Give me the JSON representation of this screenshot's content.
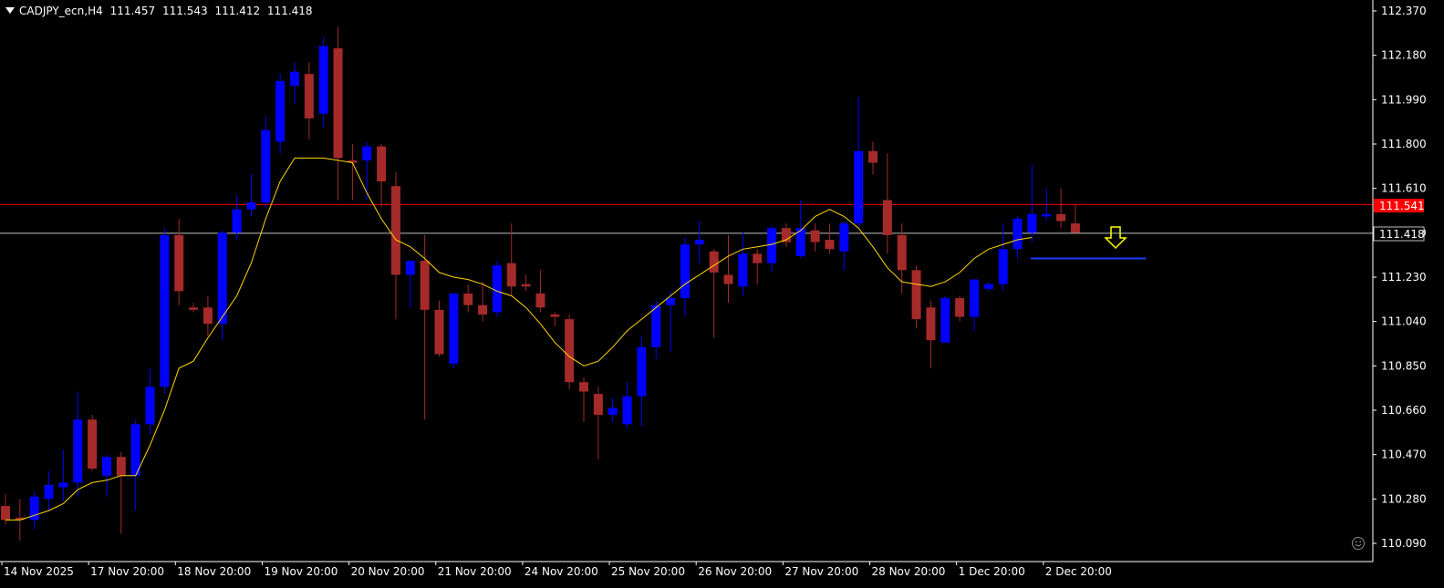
{
  "header": {
    "symbol": "CADJPY_ecn,H4",
    "open": "111.457",
    "high": "111.543",
    "low": "111.412",
    "close": "111.418"
  },
  "colors": {
    "background": "#000000",
    "bull": "#0000ff",
    "bear": "#a52a2a",
    "ma": "#ffd700",
    "resistance": "#ff0000",
    "bid": "#c0c0c0",
    "support": "#1e3cff",
    "arrow": "#ffff00",
    "axis": "#ffffff"
  },
  "price_tags": {
    "resistance": "111.541",
    "bid": "111.418"
  },
  "chart_data": {
    "type": "candlestick",
    "y_ticks": [
      "112.370",
      "112.180",
      "111.990",
      "111.800",
      "111.610",
      "111.420",
      "111.230",
      "111.040",
      "110.850",
      "110.660",
      "110.470",
      "110.280",
      "110.090"
    ],
    "x_ticks": [
      "14 Nov 2025",
      "17 Nov 20:00",
      "18 Nov 20:00",
      "19 Nov 20:00",
      "20 Nov 20:00",
      "21 Nov 20:00",
      "24 Nov 20:00",
      "25 Nov 20:00",
      "26 Nov 20:00",
      "27 Nov 20:00",
      "28 Nov 20:00",
      "1 Dec 20:00",
      "2 Dec 20:00"
    ],
    "ylim": [
      110.06,
      112.4
    ],
    "candles": [
      {
        "o": 110.25,
        "h": 110.3,
        "l": 110.17,
        "c": 110.19
      },
      {
        "o": 110.2,
        "h": 110.28,
        "l": 110.1,
        "c": 110.19
      },
      {
        "o": 110.19,
        "h": 110.31,
        "l": 110.15,
        "c": 110.29
      },
      {
        "o": 110.28,
        "h": 110.4,
        "l": 110.23,
        "c": 110.34
      },
      {
        "o": 110.33,
        "h": 110.49,
        "l": 110.27,
        "c": 110.35
      },
      {
        "o": 110.35,
        "h": 110.74,
        "l": 110.29,
        "c": 110.62
      },
      {
        "o": 110.62,
        "h": 110.64,
        "l": 110.4,
        "c": 110.41
      },
      {
        "o": 110.38,
        "h": 110.47,
        "l": 110.29,
        "c": 110.46
      },
      {
        "o": 110.46,
        "h": 110.48,
        "l": 110.13,
        "c": 110.38
      },
      {
        "o": 110.38,
        "h": 110.62,
        "l": 110.23,
        "c": 110.6
      },
      {
        "o": 110.6,
        "h": 110.84,
        "l": 110.56,
        "c": 110.76
      },
      {
        "o": 110.76,
        "h": 111.44,
        "l": 110.73,
        "c": 111.41
      },
      {
        "o": 111.41,
        "h": 111.48,
        "l": 111.11,
        "c": 111.17
      },
      {
        "o": 111.1,
        "h": 111.12,
        "l": 111.08,
        "c": 111.09
      },
      {
        "o": 111.1,
        "h": 111.15,
        "l": 110.98,
        "c": 111.03
      },
      {
        "o": 111.03,
        "h": 111.43,
        "l": 110.96,
        "c": 111.42
      },
      {
        "o": 111.42,
        "h": 111.58,
        "l": 111.39,
        "c": 111.52
      },
      {
        "o": 111.52,
        "h": 111.67,
        "l": 111.49,
        "c": 111.55
      },
      {
        "o": 111.55,
        "h": 111.92,
        "l": 111.53,
        "c": 111.86
      },
      {
        "o": 111.81,
        "h": 112.1,
        "l": 111.76,
        "c": 112.07
      },
      {
        "o": 112.05,
        "h": 112.15,
        "l": 111.97,
        "c": 112.11
      },
      {
        "o": 112.1,
        "h": 112.15,
        "l": 111.82,
        "c": 111.91
      },
      {
        "o": 111.93,
        "h": 112.26,
        "l": 111.87,
        "c": 112.22
      },
      {
        "o": 112.21,
        "h": 112.3,
        "l": 111.56,
        "c": 111.74
      },
      {
        "o": 111.73,
        "h": 111.8,
        "l": 111.56,
        "c": 111.72
      },
      {
        "o": 111.73,
        "h": 111.81,
        "l": 111.56,
        "c": 111.79
      },
      {
        "o": 111.79,
        "h": 111.8,
        "l": 111.53,
        "c": 111.64
      },
      {
        "o": 111.62,
        "h": 111.68,
        "l": 111.05,
        "c": 111.24
      },
      {
        "o": 111.24,
        "h": 111.3,
        "l": 111.1,
        "c": 111.3
      },
      {
        "o": 111.3,
        "h": 111.41,
        "l": 110.62,
        "c": 111.09
      },
      {
        "o": 111.09,
        "h": 111.13,
        "l": 110.89,
        "c": 110.9
      },
      {
        "o": 110.86,
        "h": 111.15,
        "l": 110.84,
        "c": 111.16
      },
      {
        "o": 111.16,
        "h": 111.2,
        "l": 111.08,
        "c": 111.11
      },
      {
        "o": 111.11,
        "h": 111.21,
        "l": 111.04,
        "c": 111.07
      },
      {
        "o": 111.08,
        "h": 111.3,
        "l": 111.06,
        "c": 111.28
      },
      {
        "o": 111.29,
        "h": 111.46,
        "l": 111.15,
        "c": 111.19
      },
      {
        "o": 111.2,
        "h": 111.24,
        "l": 111.17,
        "c": 111.19
      },
      {
        "o": 111.16,
        "h": 111.26,
        "l": 111.08,
        "c": 111.1
      },
      {
        "o": 111.07,
        "h": 111.08,
        "l": 111.02,
        "c": 111.06
      },
      {
        "o": 111.05,
        "h": 111.07,
        "l": 110.75,
        "c": 110.78
      },
      {
        "o": 110.78,
        "h": 110.8,
        "l": 110.61,
        "c": 110.74
      },
      {
        "o": 110.73,
        "h": 110.76,
        "l": 110.45,
        "c": 110.64
      },
      {
        "o": 110.64,
        "h": 110.71,
        "l": 110.61,
        "c": 110.67
      },
      {
        "o": 110.6,
        "h": 110.78,
        "l": 110.58,
        "c": 110.72
      },
      {
        "o": 110.72,
        "h": 110.98,
        "l": 110.59,
        "c": 110.93
      },
      {
        "o": 110.93,
        "h": 111.13,
        "l": 110.88,
        "c": 111.11
      },
      {
        "o": 111.11,
        "h": 111.17,
        "l": 110.91,
        "c": 111.14
      },
      {
        "o": 111.14,
        "h": 111.4,
        "l": 111.06,
        "c": 111.37
      },
      {
        "o": 111.37,
        "h": 111.47,
        "l": 111.29,
        "c": 111.39
      },
      {
        "o": 111.34,
        "h": 111.35,
        "l": 110.97,
        "c": 111.25
      },
      {
        "o": 111.24,
        "h": 111.41,
        "l": 111.12,
        "c": 111.2
      },
      {
        "o": 111.19,
        "h": 111.42,
        "l": 111.15,
        "c": 111.33
      },
      {
        "o": 111.33,
        "h": 111.35,
        "l": 111.2,
        "c": 111.29
      },
      {
        "o": 111.29,
        "h": 111.45,
        "l": 111.25,
        "c": 111.44
      },
      {
        "o": 111.44,
        "h": 111.46,
        "l": 111.36,
        "c": 111.38
      },
      {
        "o": 111.32,
        "h": 111.56,
        "l": 111.31,
        "c": 111.44
      },
      {
        "o": 111.43,
        "h": 111.46,
        "l": 111.34,
        "c": 111.38
      },
      {
        "o": 111.39,
        "h": 111.46,
        "l": 111.33,
        "c": 111.35
      },
      {
        "o": 111.34,
        "h": 111.47,
        "l": 111.26,
        "c": 111.46
      },
      {
        "o": 111.46,
        "h": 112.0,
        "l": 111.44,
        "c": 111.77
      },
      {
        "o": 111.77,
        "h": 111.81,
        "l": 111.67,
        "c": 111.72
      },
      {
        "o": 111.56,
        "h": 111.76,
        "l": 111.33,
        "c": 111.41
      },
      {
        "o": 111.41,
        "h": 111.46,
        "l": 111.16,
        "c": 111.26
      },
      {
        "o": 111.26,
        "h": 111.28,
        "l": 111.01,
        "c": 111.05
      },
      {
        "o": 111.1,
        "h": 111.13,
        "l": 110.84,
        "c": 110.96
      },
      {
        "o": 110.95,
        "h": 111.15,
        "l": 110.95,
        "c": 111.14
      },
      {
        "o": 111.14,
        "h": 111.15,
        "l": 111.04,
        "c": 111.06
      },
      {
        "o": 111.06,
        "h": 111.22,
        "l": 111.0,
        "c": 111.22
      },
      {
        "o": 111.18,
        "h": 111.21,
        "l": 111.17,
        "c": 111.2
      },
      {
        "o": 111.2,
        "h": 111.46,
        "l": 111.17,
        "c": 111.35
      },
      {
        "o": 111.35,
        "h": 111.49,
        "l": 111.31,
        "c": 111.48
      },
      {
        "o": 111.42,
        "h": 111.71,
        "l": 111.38,
        "c": 111.5
      },
      {
        "o": 111.49,
        "h": 111.61,
        "l": 111.47,
        "c": 111.5
      },
      {
        "o": 111.5,
        "h": 111.61,
        "l": 111.44,
        "c": 111.47
      },
      {
        "o": 111.46,
        "h": 111.54,
        "l": 111.42,
        "c": 111.42
      }
    ],
    "moving_average": [
      110.19,
      110.19,
      110.21,
      110.23,
      110.26,
      110.32,
      110.35,
      110.36,
      110.38,
      110.38,
      110.51,
      110.66,
      110.84,
      110.87,
      110.97,
      111.06,
      111.15,
      111.29,
      111.48,
      111.64,
      111.74,
      111.74,
      111.74,
      111.73,
      111.72,
      111.59,
      111.48,
      111.39,
      111.36,
      111.31,
      111.25,
      111.23,
      111.22,
      111.2,
      111.17,
      111.15,
      111.1,
      111.03,
      110.95,
      110.89,
      110.85,
      110.87,
      110.93,
      111.0,
      111.05,
      111.1,
      111.15,
      111.2,
      111.24,
      111.28,
      111.32,
      111.35,
      111.36,
      111.37,
      111.39,
      111.43,
      111.49,
      111.52,
      111.49,
      111.44,
      111.36,
      111.27,
      111.21,
      111.2,
      111.19,
      111.21,
      111.25,
      111.31,
      111.35,
      111.37,
      111.39,
      111.4
    ],
    "resistance_level": 111.541,
    "bid_level": 111.418,
    "support_level": 111.31
  }
}
